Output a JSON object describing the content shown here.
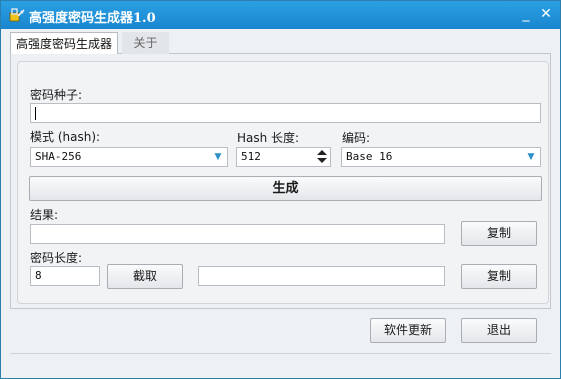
{
  "window": {
    "title": "高强度密码生成器1.0"
  },
  "titlebar": {
    "minimize_glyph": "_",
    "close_glyph": "✕"
  },
  "tabs": [
    {
      "label": "高强度密码生成器",
      "active": true
    },
    {
      "label": "关于",
      "active": false
    }
  ],
  "form": {
    "seed_label": "密码种子:",
    "seed_value": "",
    "mode_label": "模式 (hash):",
    "mode_selected": "SHA-256",
    "hash_length_label": "Hash 长度:",
    "hash_length_value": "512",
    "encoding_label": "编码:",
    "encoding_selected": "Base 16",
    "generate_label": "生成",
    "result_label": "结果:",
    "result_value": "",
    "copy_label": "复制",
    "pwd_length_label": "密码长度:",
    "pwd_length_value": "8",
    "truncate_label": "截取",
    "truncated_value": "",
    "copy2_label": "复制"
  },
  "footer": {
    "update_label": "软件更新",
    "exit_label": "退出"
  },
  "colors": {
    "titlebar": "#1a86cf",
    "accent": "#2b8fc9"
  },
  "icons": {
    "app": "app-logo-icon",
    "combo": "chevron-down-icon",
    "spin": "spin-arrows-icon"
  }
}
